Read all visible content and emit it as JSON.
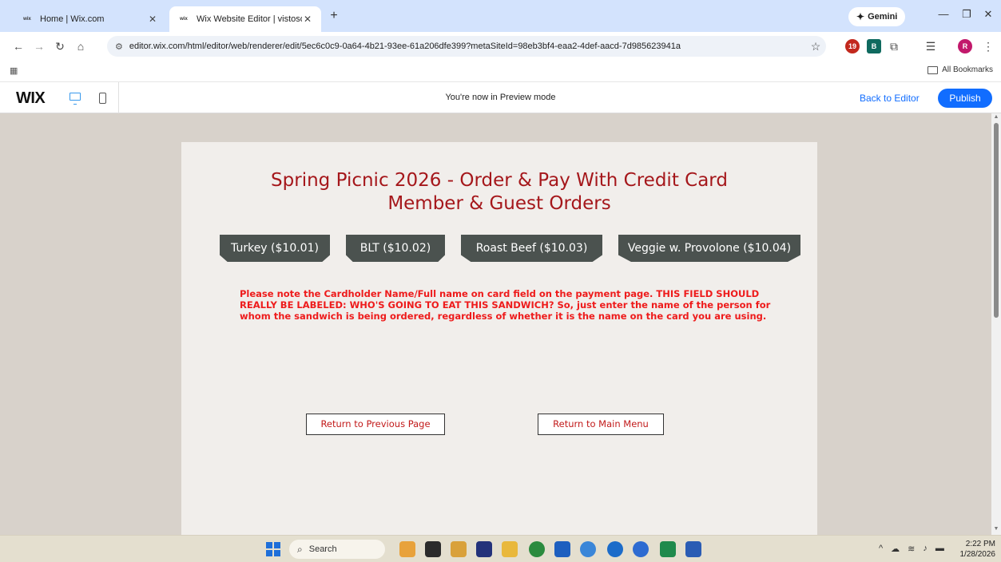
{
  "browser": {
    "tabs": [
      {
        "favicon": "wix",
        "title": "Home | Wix.com",
        "active": false
      },
      {
        "favicon": "wix",
        "title": "Wix Website Editor | vistosohik",
        "active": true
      }
    ],
    "new_tab": "+",
    "gemini_label": "Gemini",
    "url": "editor.wix.com/html/editor/web/renderer/edit/5ec6c0c9-0a64-4b21-93ee-61a206dfe399?metaSiteId=98eb3bf4-eaa2-4def-aacd-7d985623941a",
    "extension_badge": "19",
    "extension_b": "B",
    "profile_initial": "R",
    "all_bookmarks": "All Bookmarks"
  },
  "wix_bar": {
    "logo": "WIX",
    "preview_message": "You're now in Preview mode",
    "back_to_editor": "Back to Editor",
    "publish": "Publish"
  },
  "page": {
    "title_line1": "Spring Picnic 2026 - Order & Pay With Credit Card",
    "title_line2": "Member & Guest Orders",
    "sandwich_buttons": [
      "Turkey ($10.01)",
      "BLT ($10.02)",
      "Roast Beef ($10.03)",
      "Veggie w. Provolone ($10.04)"
    ],
    "notice": "Please note the Cardholder Name/Full name on card field on the payment page.  THIS FIELD SHOULD REALLY BE LABELED: WHO'S GOING TO EAT THIS SANDWICH?  So, just enter the name of the person for whom the sandwich is being ordered, regardless of whether it is the name on the card you are using.",
    "return_previous": "Return to Previous Page",
    "return_main": "Return to Main Menu"
  },
  "taskbar": {
    "search_placeholder": "Search",
    "time": "2:22 PM",
    "date": "1/28/2026"
  },
  "colors": {
    "title_red": "#a5171b",
    "notice_red": "#ee1b1b",
    "button_gray": "#4b524f",
    "canvas_bg": "#d8d2cb",
    "page_bg": "#f1eeeb",
    "wix_blue": "#116dff"
  }
}
